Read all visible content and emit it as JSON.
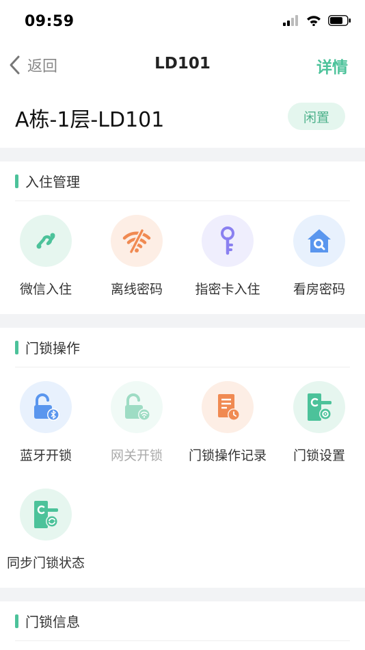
{
  "status_bar": {
    "time": "09:59"
  },
  "nav": {
    "back_label": "返回",
    "title": "LD101",
    "detail_label": "详情"
  },
  "room": {
    "name": "A栋-1层-LD101",
    "status": "闲置"
  },
  "sections": {
    "checkin": {
      "title": "入住管理",
      "items": [
        {
          "label": "微信入住",
          "icon": "wechat-mini-program-icon"
        },
        {
          "label": "离线密码",
          "icon": "wifi-off-icon"
        },
        {
          "label": "指密卡入住",
          "icon": "key-icon"
        },
        {
          "label": "看房密码",
          "icon": "house-search-icon"
        }
      ]
    },
    "lock_ops": {
      "title": "门锁操作",
      "items": [
        {
          "label": "蓝牙开锁",
          "icon": "bluetooth-unlock-icon"
        },
        {
          "label": "网关开锁",
          "icon": "gateway-unlock-icon"
        },
        {
          "label": "门锁操作记录",
          "icon": "record-document-icon"
        },
        {
          "label": "门锁设置",
          "icon": "lock-settings-icon"
        },
        {
          "label": "同步门锁状态",
          "icon": "lock-sync-icon"
        }
      ]
    },
    "lock_info": {
      "title": "门锁信息"
    }
  },
  "colors": {
    "accent": "#4cc29a",
    "orange": "#f08a52",
    "purple": "#8a80f0",
    "blue": "#5a96ee",
    "disabled_text": "#aaaaaa"
  }
}
